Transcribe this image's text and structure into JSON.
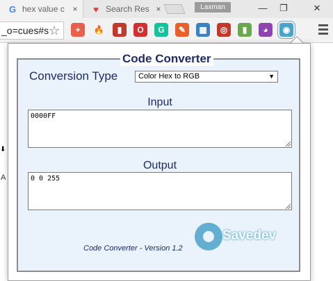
{
  "browser": {
    "tabs": [
      {
        "title": "hex value c",
        "icon": "google-g-icon",
        "icon_glyph": "G",
        "icon_color": "#4285f4",
        "close": "×"
      },
      {
        "title": "Search Res",
        "icon": "heart-icon",
        "icon_glyph": "♥",
        "icon_color": "#e53935",
        "close": "×"
      }
    ],
    "profile_name": "Laxman",
    "window_controls": {
      "minimize": "—",
      "restore": "❐",
      "close": "✕"
    },
    "address_text": "_o=cues#s",
    "star_glyph": "☆",
    "extensions": [
      {
        "name": "plus-extension-icon",
        "glyph": "+",
        "color": "#e8604c"
      },
      {
        "name": "fire-extension-icon",
        "glyph": "🔥",
        "color": "transparent"
      },
      {
        "name": "book-extension-icon",
        "glyph": "▮",
        "color": "#c0392b"
      },
      {
        "name": "adblock-extension-icon",
        "glyph": "O",
        "color": "#d32f2f"
      },
      {
        "name": "grammarly-extension-icon",
        "glyph": "G",
        "color": "#15c39a"
      },
      {
        "name": "pencil-extension-icon",
        "glyph": "✎",
        "color": "#e8602c"
      },
      {
        "name": "grid-extension-icon",
        "glyph": "▦",
        "color": "#3b82c4"
      },
      {
        "name": "target-extension-icon",
        "glyph": "◎",
        "color": "#c0392b"
      },
      {
        "name": "mic-extension-icon",
        "glyph": "▮",
        "color": "#6aa84f"
      },
      {
        "name": "colorwheel-extension-icon",
        "glyph": "◕",
        "color": "#8e44ad"
      },
      {
        "name": "savedev-extension-icon",
        "glyph": "◉",
        "color": "#4aa3c9"
      }
    ]
  },
  "popup": {
    "title": "Code Converter",
    "conversion_label": "Conversion Type",
    "conversion_selected": "Color Hex to RGB",
    "input_label": "Input",
    "input_value": "0000FF",
    "output_label": "Output",
    "output_value": "0 0 255",
    "footer": "Code Converter - Version 1.2",
    "logo_text": "Savedev"
  }
}
